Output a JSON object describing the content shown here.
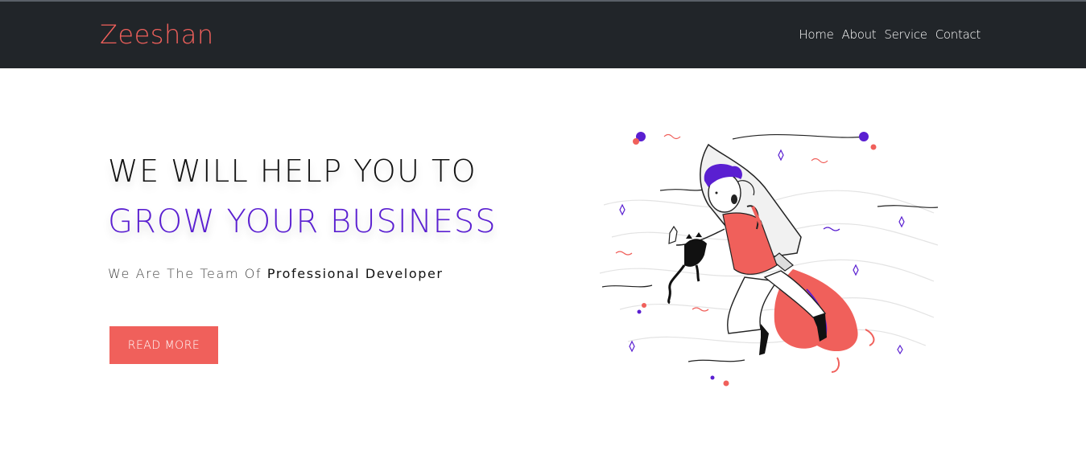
{
  "navbar": {
    "brand": "Zeeshan",
    "links": [
      "Home",
      "About",
      "Service",
      "Contact"
    ]
  },
  "hero": {
    "line1": "WE WILL HELP YOU TO",
    "line2": "GROW YOUR BUSINESS",
    "tagline_prefix": "We Are The Team Of ",
    "tagline_emphasis": "Professional Developer",
    "button_label": "READ MORE"
  },
  "illustration": {
    "icons": [
      "rocket-icon",
      "person-icon",
      "cat-icon",
      "flame-icon"
    ]
  },
  "colors": {
    "navbar_bg": "#212529",
    "accent": "#f0605b",
    "purple": "#5a1fd1",
    "text": "#111111"
  }
}
